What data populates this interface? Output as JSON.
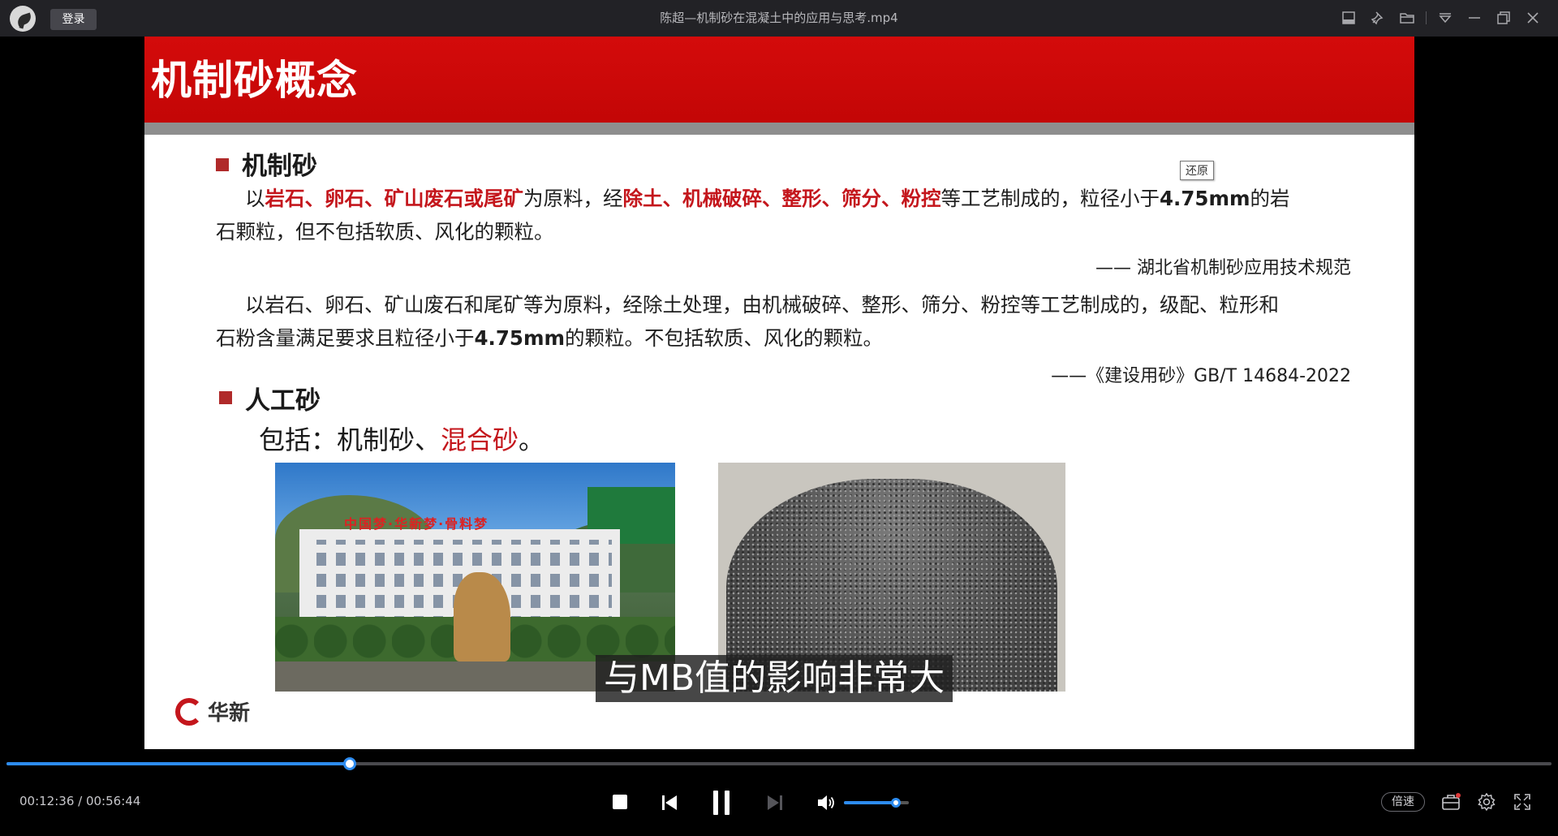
{
  "titlebar": {
    "login_label": "登录",
    "window_title": "陈超—机制砂在混凝土中的应用与思考.mp4",
    "icons": [
      "mini-player-icon",
      "pin-icon",
      "folder-icon",
      "menu-dropdown-icon",
      "minimize-icon",
      "restore-window-icon",
      "close-icon"
    ]
  },
  "slide": {
    "title": "机制砂概念",
    "restore_tooltip": "还原",
    "section1": {
      "heading": "机制砂",
      "para1": {
        "p1": "以",
        "r1": "岩石、卵石、矿山废石或尾矿",
        "p2": "为原料，经",
        "r2": "除土、机械破碎、整形、筛分、粉控",
        "p3": "等工艺制成的，粒径小于",
        "b1": "4.75mm",
        "p4": "的岩",
        "line2": "石颗粒，但不包括软质、风化的颗粒。"
      },
      "cite1": "—— 湖北省机制砂应用技术规范",
      "para2": {
        "line1a": "以岩石、卵石、矿山废石和尾矿等为原料，经除土处理，由机械破碎、整形、筛分、粉控等工艺制成的，级配、粒形和",
        "line2a": "石粉含量满足要求且粒径小于",
        "line2b": "4.75mm",
        "line2c": "的颗粒。不包括软质、风化的颗粒。"
      },
      "cite2": "——《建设用砂》GB/T 14684-2022"
    },
    "section2": {
      "heading": "人工砂",
      "include_prefix": "包括：机制砂、",
      "include_red": "混合砂",
      "include_suffix": "。"
    },
    "factory_sign": "中国梦·华新梦·骨料梦",
    "logo_text": "华新"
  },
  "subtitle": "与MB值的影响非常大",
  "player": {
    "current_time": "00:12:36",
    "separator": " / ",
    "total_time": "00:56:44",
    "progress_fraction": 0.222,
    "volume_fraction": 0.8,
    "speed_label": "倍速",
    "accent_color": "#2d8cf0"
  }
}
